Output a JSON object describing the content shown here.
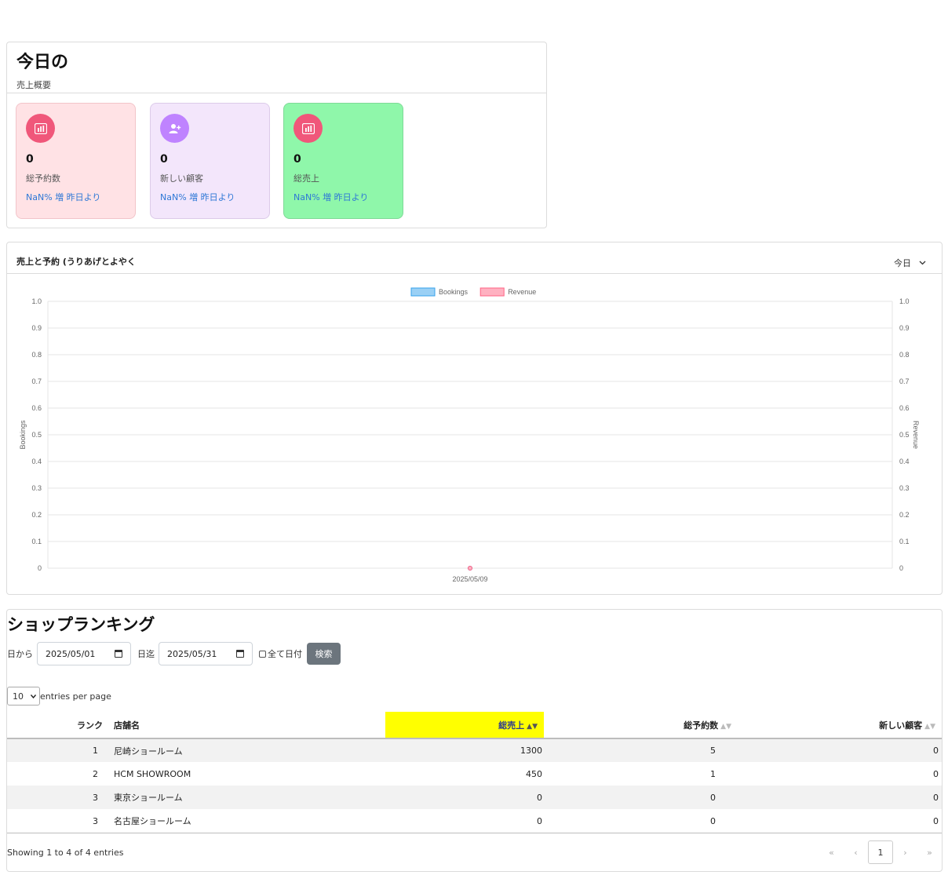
{
  "summary": {
    "title": "今日の",
    "subtitle": "売上概要",
    "cards": [
      {
        "value": "0",
        "label": "総予約数",
        "trend": "NaN% 増 昨日より",
        "icon": "bar-chart-icon"
      },
      {
        "value": "0",
        "label": "新しい顧客",
        "trend": "NaN% 増 昨日より",
        "icon": "user-plus-icon"
      },
      {
        "value": "0",
        "label": "総売上",
        "trend": "NaN% 増 昨日より",
        "icon": "bar-chart-icon"
      }
    ],
    "colors": {
      "pink_card": "#ffe2e5",
      "purple_card": "#f3e6fb",
      "green_card": "#8ff7aa",
      "pink_icon": "#f0577a",
      "purple_icon": "#bf83ff",
      "trend_text": "#2e78d6"
    }
  },
  "chart_panel": {
    "title": "売上と予約 (うりあげとよやく",
    "filter_label": "今日"
  },
  "chart_data": {
    "type": "line",
    "x": [
      "2025/05/09"
    ],
    "series": [
      {
        "name": "Bookings",
        "values": [
          0
        ],
        "color": "#36a2eb",
        "axis": "left"
      },
      {
        "name": "Revenue",
        "values": [
          0
        ],
        "color": "#ff6384",
        "axis": "right"
      }
    ],
    "ylabel": "Bookings",
    "y2label": "Revenue",
    "ylim": [
      0,
      1
    ],
    "y2lim": [
      0,
      1
    ],
    "yticks": [
      "0",
      "0.1",
      "0.2",
      "0.3",
      "0.4",
      "0.5",
      "0.6",
      "0.7",
      "0.8",
      "0.9",
      "1.0"
    ],
    "grid": true,
    "legend": "top-center"
  },
  "ranking": {
    "title": "ショップランキング",
    "from_label": "日から",
    "from_value": "2025/05/01",
    "to_label": "日迄",
    "to_value": "2025/05/31",
    "all_dates_label": "全て日付",
    "search_label": "検索",
    "per_page_value": "10",
    "per_page_label": "entries per page",
    "columns": [
      "ランク",
      "店舗名",
      "総売上",
      "総予約数",
      "新しい顧客"
    ],
    "rows": [
      {
        "rank": "1",
        "name": "尼崎ショールーム",
        "sales": "1300",
        "bookings": "5",
        "new_customers": "0"
      },
      {
        "rank": "2",
        "name": "HCM SHOWROOM",
        "sales": "450",
        "bookings": "1",
        "new_customers": "0"
      },
      {
        "rank": "3",
        "name": "東京ショールーム",
        "sales": "0",
        "bookings": "0",
        "new_customers": "0"
      },
      {
        "rank": "3",
        "name": "名古屋ショールーム",
        "sales": "0",
        "bookings": "0",
        "new_customers": "0"
      }
    ],
    "info": "Showing 1 to 4 of 4 entries",
    "pager": {
      "first": "«",
      "prev": "‹",
      "current": "1",
      "next": "›",
      "last": "»"
    },
    "highlight_color": "#ffff00"
  }
}
